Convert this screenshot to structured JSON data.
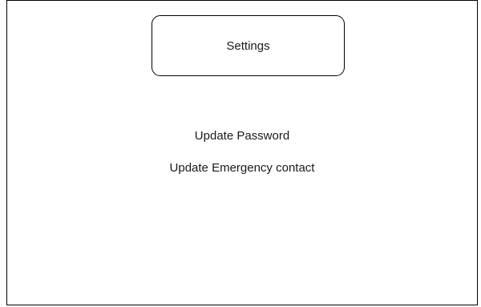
{
  "header": {
    "title": "Settings"
  },
  "menu": {
    "items": [
      {
        "label": "Update Password"
      },
      {
        "label": "Update Emergency contact"
      }
    ]
  },
  "colors": {
    "background": "#ffffff",
    "border": "#000000",
    "text": "#1a1a1a"
  }
}
